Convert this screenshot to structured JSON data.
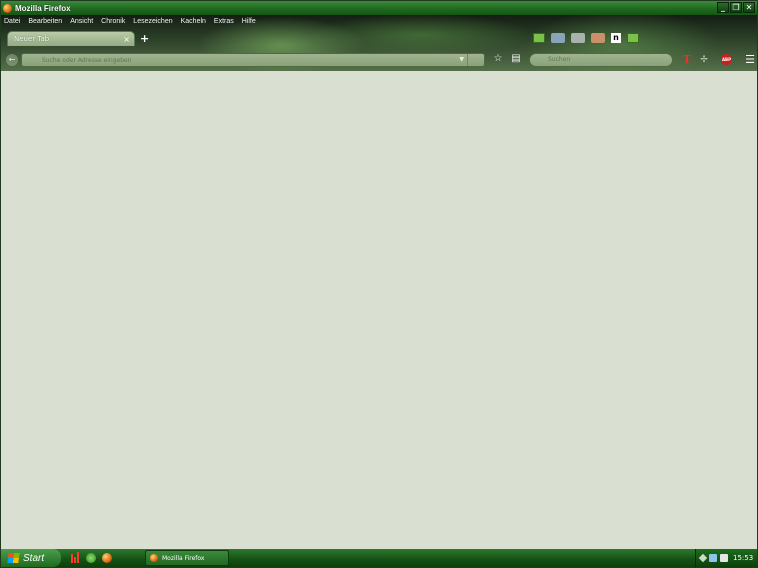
{
  "window": {
    "title": "Mozilla Firefox",
    "controls": {
      "minimize": "_",
      "restore": "❐",
      "close": "✕"
    }
  },
  "menubar": {
    "items": [
      "Datei",
      "Bearbeiten",
      "Ansicht",
      "Chronik",
      "Lesezeichen",
      "Kacheln",
      "Extras",
      "Hilfe"
    ]
  },
  "tabs": {
    "active_label": "Neuer Tab",
    "close_glyph": "×",
    "new_tab_glyph": "+"
  },
  "navbar": {
    "back_glyph": "←",
    "url_placeholder": "Suche oder Adresse eingeben",
    "dropdown_glyph": "▼",
    "bookmark_glyph": "☆",
    "reader_glyph": "▤",
    "search_placeholder": "Suchen",
    "t_glyph": "T",
    "puzzle_glyph": "✢",
    "abp_label": "ABP",
    "menu_glyph": "☰"
  },
  "taskbar": {
    "start_label": "Start",
    "task_label": "Mozilla Firefox",
    "clock": "15:53"
  },
  "colors": {
    "accent_green": "#1f6a1f",
    "content_bg": "#d9e0d2",
    "abp_red": "#c8201c"
  }
}
